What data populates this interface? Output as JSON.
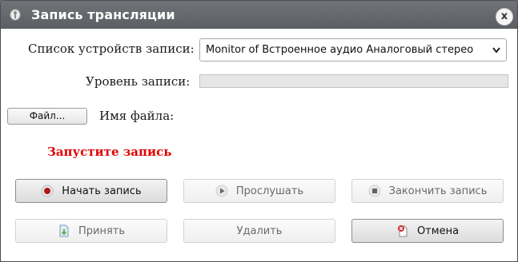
{
  "window": {
    "title": "Запись трансляции",
    "close_label": "x"
  },
  "form": {
    "device_label": "Список устройств записи:",
    "device_selected": "Monitor of Встроенное аудио Аналоговый стерео",
    "level_label": "Уровень записи:",
    "level_value": 0,
    "file_button": "Файл...",
    "filename_label": "Имя файла:",
    "status_text": "Запустите запись"
  },
  "buttons": {
    "start": "Начать запись",
    "listen": "Прослушать",
    "stop": "Закончить запись",
    "accept": "Принять",
    "delete": "Удалить",
    "cancel": "Отмена"
  },
  "colors": {
    "status": "#e00000",
    "titlebar": "#65686d"
  }
}
